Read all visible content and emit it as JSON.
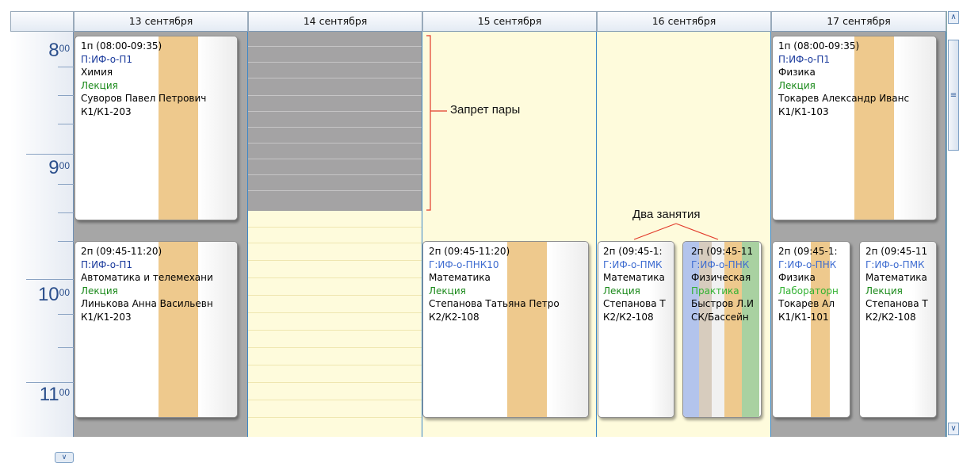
{
  "days": [
    "13 сентября",
    "14 сентября",
    "15 сентября",
    "16 сентября",
    "17 сентября"
  ],
  "hours": [
    "8",
    "9",
    "10",
    "11"
  ],
  "hour_suffix": "00",
  "annotations": {
    "banned": "Запрет пары",
    "two_lessons": "Два занятия"
  },
  "lessons": {
    "d13_1": {
      "time": "1п (08:00-09:35)",
      "group": "П:ИФ-о-П1",
      "subject": "Химия",
      "type": "Лекция",
      "teacher": "Суворов Павел Петрович",
      "room": "К1/К1-203"
    },
    "d13_2": {
      "time": "2п (09:45-11:20)",
      "group": "П:ИФ-о-П1",
      "subject": "Автоматика и телемехани",
      "type": "Лекция",
      "teacher": "Линькова Анна Васильевн",
      "room": "К1/К1-203"
    },
    "d15_2": {
      "time": "2п (09:45-11:20)",
      "group": "Г:ИФ-о-ПНК10",
      "subject": "Математика",
      "type": "Лекция",
      "teacher": "Степанова Татьяна Петро",
      "room": "К2/К2-108"
    },
    "d16_2a": {
      "time": "2п (09:45-1:",
      "group": "Г:ИФ-о-ПМК",
      "subject": "Математика",
      "type": "Лекция",
      "teacher": "Степанова Т",
      "room": "К2/К2-108"
    },
    "d16_2b": {
      "time": "2п (09:45-11",
      "group": "Г:ИФ-о-ПНК",
      "subject": "Физическая",
      "type": "Практика",
      "teacher": "Быстров Л.И",
      "room": "СК/Бассейн"
    },
    "d17_1": {
      "time": "1п (08:00-09:35)",
      "group": "П:ИФ-о-П1",
      "subject": "Физика",
      "type": "Лекция",
      "teacher": "Токарев Александр Иванс",
      "room": "К1/К1-103"
    },
    "d17_2a": {
      "time": "2п (09:45-1:",
      "group": "Г:ИФ-о-ПНК",
      "subject": "Физика",
      "type": "Лабораторн",
      "teacher": "Токарев Ал",
      "room": "К1/К1-101"
    },
    "d17_2b": {
      "time": "2п (09:45-11",
      "group": "Г:ИФ-о-ПМК",
      "subject": "Математика",
      "type": "Лекция",
      "teacher": "Степанова Т",
      "room": "К2/К2-108"
    }
  },
  "scroll_icons": {
    "up": "chevron-up-icon",
    "down": "chevron-down-icon",
    "grip": "grip-icon"
  },
  "colors": {
    "stripe": "#eec98d",
    "blocked": "#a4a3a4",
    "free_day": "#fefbdc",
    "accent": "#3a86c8",
    "annotation": "#e23a2a"
  }
}
